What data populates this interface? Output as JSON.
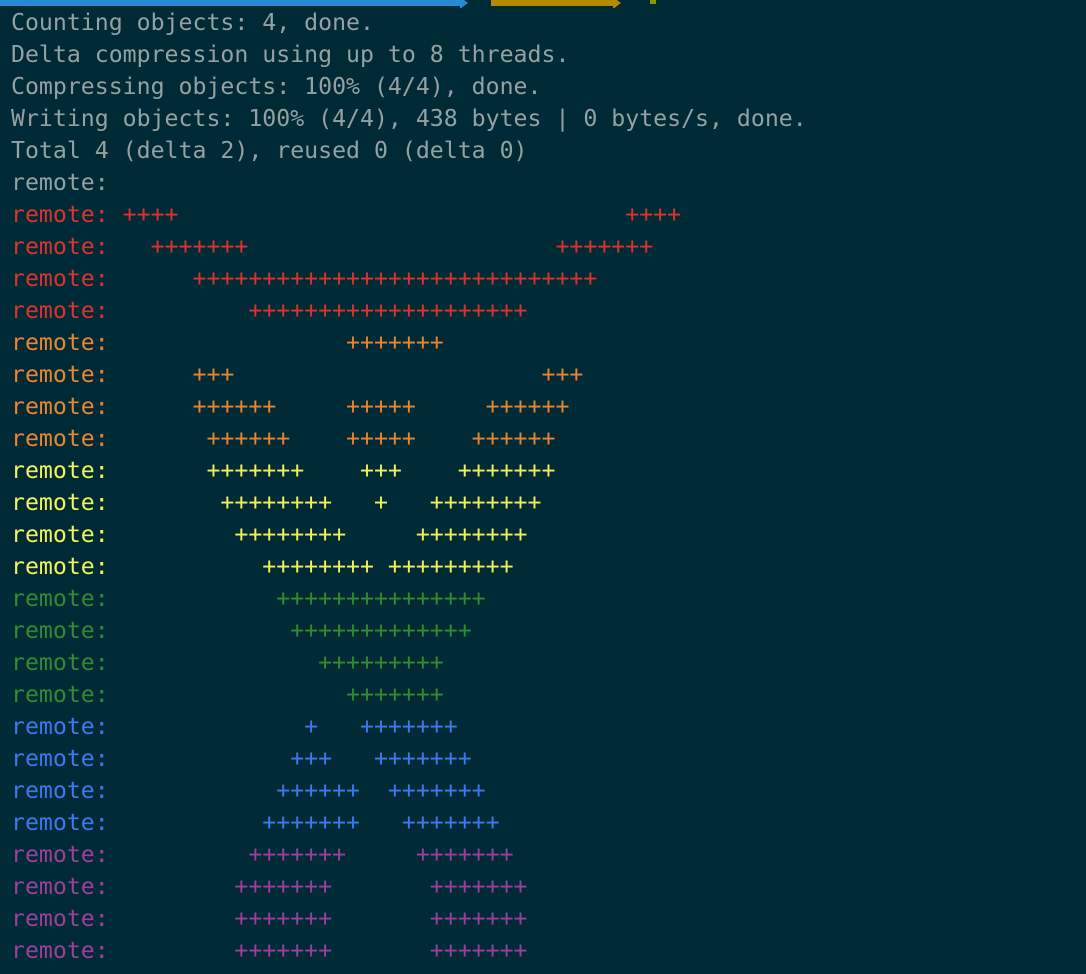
{
  "colors": {
    "background": "#002b36",
    "text": "#93a1a1",
    "red": "#dc322f",
    "orange": "#e88533",
    "yellow": "#f2f25a",
    "green": "#2e8b2e",
    "blue": "#3a78f0",
    "purple": "#9b3f9b",
    "prompt_path_segment": "#268bd2",
    "prompt_branch_segment": "#b58900"
  },
  "git_output": [
    "Counting objects: 4, done.",
    "Delta compression using up to 8 threads.",
    "Compressing objects: 100% (4/4), done.",
    "Writing objects: 100% (4/4), 438 bytes | 0 bytes/s, done.",
    "Total 4 (delta 2), reused 0 (delta 0)",
    "remote:"
  ],
  "remote_art": [
    {
      "color": "red",
      "text": "remote: ++++                                ++++"
    },
    {
      "color": "red",
      "text": "remote:   +++++++                      +++++++"
    },
    {
      "color": "red",
      "text": "remote:      +++++++++++++++++++++++++++++"
    },
    {
      "color": "red",
      "text": "remote:          ++++++++++++++++++++"
    },
    {
      "color": "orange",
      "text": "remote:                 +++++++"
    },
    {
      "color": "orange",
      "text": "remote:      +++                      +++"
    },
    {
      "color": "orange",
      "text": "remote:      ++++++     +++++     ++++++"
    },
    {
      "color": "orange",
      "text": "remote:       ++++++    +++++    ++++++"
    },
    {
      "color": "yellow",
      "text": "remote:       +++++++    +++    +++++++"
    },
    {
      "color": "yellow",
      "text": "remote:        ++++++++   +   ++++++++"
    },
    {
      "color": "yellow",
      "text": "remote:         ++++++++     ++++++++"
    },
    {
      "color": "yellow",
      "text": "remote:           ++++++++ +++++++++"
    },
    {
      "color": "green",
      "text": "remote:            +++++++++++++++"
    },
    {
      "color": "green",
      "text": "remote:             +++++++++++++"
    },
    {
      "color": "green",
      "text": "remote:               +++++++++"
    },
    {
      "color": "green",
      "text": "remote:                 +++++++"
    },
    {
      "color": "blue",
      "text": "remote:              +   +++++++"
    },
    {
      "color": "blue",
      "text": "remote:             +++   +++++++"
    },
    {
      "color": "blue",
      "text": "remote:            ++++++  +++++++"
    },
    {
      "color": "blue",
      "text": "remote:           +++++++   +++++++"
    },
    {
      "color": "purple",
      "text": "remote:          +++++++     +++++++"
    },
    {
      "color": "purple",
      "text": "remote:         +++++++       +++++++"
    },
    {
      "color": "purple",
      "text": "remote:         +++++++       +++++++"
    },
    {
      "color": "purple",
      "text": "remote:         +++++++       +++++++"
    }
  ]
}
